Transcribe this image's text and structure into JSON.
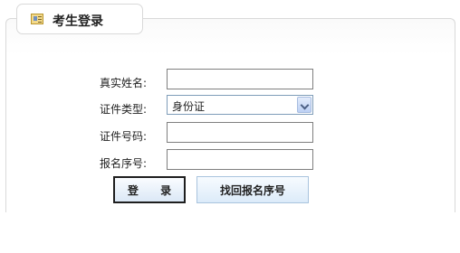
{
  "panel": {
    "title": "考生登录",
    "icon": "id-card-icon"
  },
  "form": {
    "name_label": "真实姓名:",
    "name_value": "",
    "id_type_label": "证件类型:",
    "id_type_selected": "身份证",
    "id_number_label": "证件号码:",
    "id_number_value": "",
    "serial_label": "报名序号:",
    "serial_value": ""
  },
  "buttons": {
    "login_label": "登 录",
    "find_serial_label": "找回报名序号"
  }
}
